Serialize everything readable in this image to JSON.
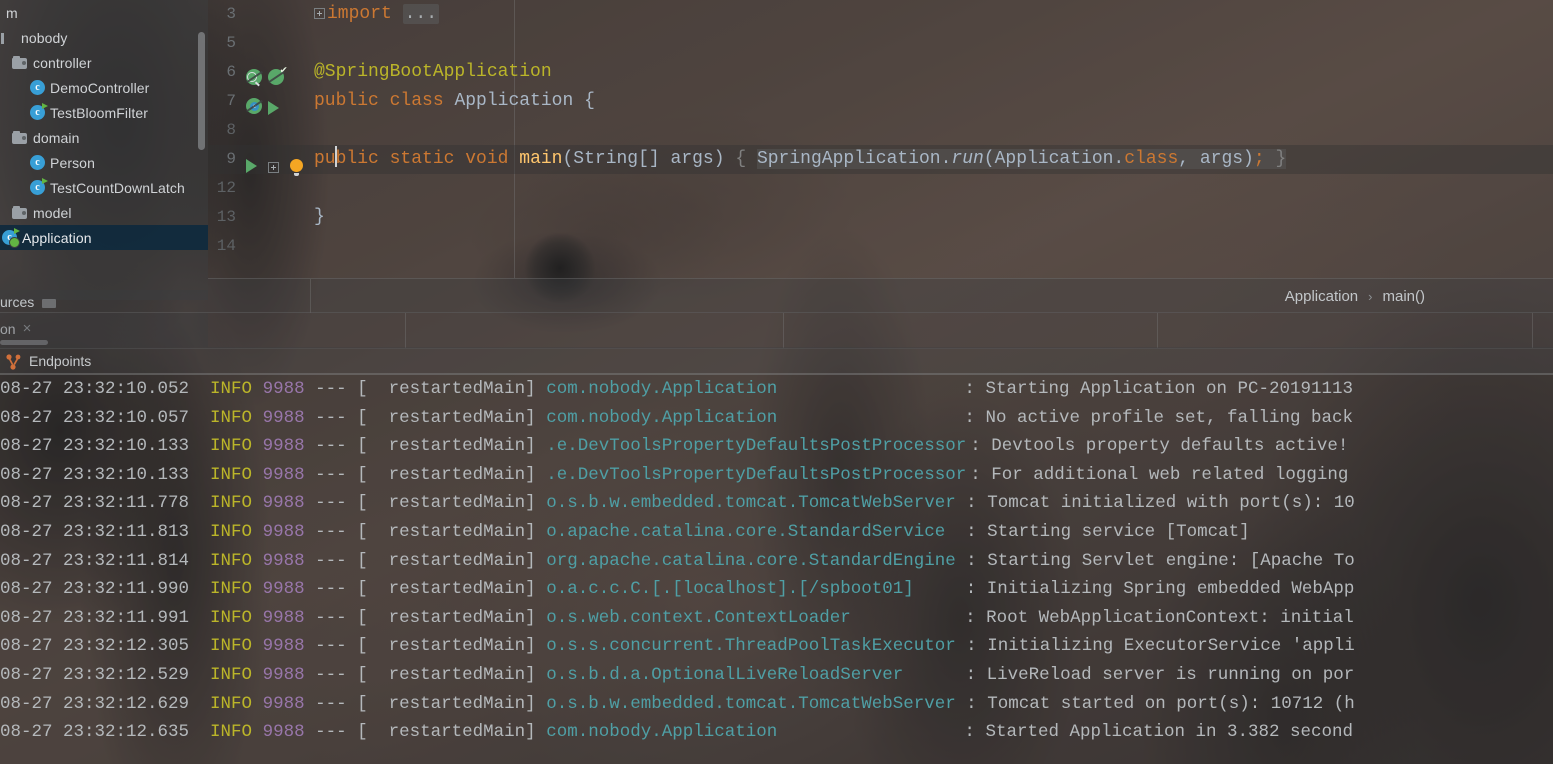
{
  "project_tree": {
    "items": [
      {
        "label": "m",
        "icon": "none",
        "indent": 0,
        "selected": false,
        "clipped": true
      },
      {
        "label": "nobody",
        "icon": "package",
        "indent": 0,
        "selected": false,
        "clipped": true
      },
      {
        "label": "controller",
        "icon": "folder",
        "indent": 12,
        "selected": false,
        "clipped": false
      },
      {
        "label": "DemoController",
        "icon": "java-class",
        "indent": 30,
        "selected": false,
        "clipped": false
      },
      {
        "label": "TestBloomFilter",
        "icon": "java-runnable",
        "indent": 30,
        "selected": false,
        "clipped": false
      },
      {
        "label": "domain",
        "icon": "folder",
        "indent": 12,
        "selected": false,
        "clipped": false
      },
      {
        "label": "Person",
        "icon": "java-class",
        "indent": 30,
        "selected": false,
        "clipped": false
      },
      {
        "label": "TestCountDownLatch",
        "icon": "java-runnable",
        "indent": 30,
        "selected": false,
        "clipped": false
      },
      {
        "label": "model",
        "icon": "folder",
        "indent": 12,
        "selected": false,
        "clipped": false
      },
      {
        "label": "Application",
        "icon": "spring-class",
        "indent": 2,
        "selected": true,
        "clipped": false
      }
    ]
  },
  "left_tabs": {
    "tabs": [
      {
        "label": "urces",
        "close": ""
      },
      {
        "label": "on",
        "close": "×"
      }
    ]
  },
  "editor": {
    "lines": [
      {
        "no": "3",
        "dim": false,
        "current": false,
        "gutter": [],
        "fold": true,
        "tokens": [
          {
            "t": "import ",
            "c": "tok-kw"
          },
          {
            "t": "...",
            "c": "import-ellipsis"
          }
        ]
      },
      {
        "no": "5",
        "dim": false,
        "current": false,
        "gutter": [],
        "fold": false,
        "tokens": []
      },
      {
        "no": "6",
        "dim": false,
        "current": false,
        "gutter": [
          "bean-search",
          "bean-check"
        ],
        "fold": false,
        "tokens": [
          {
            "t": "@SpringBootApplication",
            "c": "tok-ann"
          }
        ]
      },
      {
        "no": "7",
        "dim": false,
        "current": false,
        "gutter": [
          "bean-blue",
          "run"
        ],
        "fold": false,
        "tokens": [
          {
            "t": "public ",
            "c": "tok-kw"
          },
          {
            "t": "class ",
            "c": "tok-kw"
          },
          {
            "t": "Application",
            "c": "tok-type"
          },
          {
            "t": " {",
            "c": "tok-plain"
          }
        ]
      },
      {
        "no": "8",
        "dim": true,
        "current": false,
        "gutter": [],
        "fold": false,
        "tokens": []
      },
      {
        "no": "9",
        "dim": false,
        "current": true,
        "gutter": [
          "run",
          "fold",
          "bulb"
        ],
        "fold": false,
        "tokens": [
          {
            "t": "pu",
            "c": "tok-kw"
          },
          {
            "t": "CARET",
            "c": "caret"
          },
          {
            "t": "blic ",
            "c": "tok-kw"
          },
          {
            "t": "static ",
            "c": "tok-kw"
          },
          {
            "t": "void ",
            "c": "tok-kw"
          },
          {
            "t": "main",
            "c": "tok-method"
          },
          {
            "t": "(",
            "c": "tok-plain"
          },
          {
            "t": "String",
            "c": "tok-type"
          },
          {
            "t": "[] ",
            "c": "tok-plain"
          },
          {
            "t": "args",
            "c": "tok-plain"
          },
          {
            "t": ") ",
            "c": "tok-plain"
          },
          {
            "t": "{ ",
            "c": "tok-dim"
          },
          {
            "t": "SpringApplication.",
            "c": "tok-type hl-usage"
          },
          {
            "t": "run",
            "c": "tok-italic hl-usage"
          },
          {
            "t": "(Application.",
            "c": "tok-type hl-usage"
          },
          {
            "t": "class",
            "c": "tok-kw hl-usage"
          },
          {
            "t": ", args)",
            "c": "tok-type hl-usage"
          },
          {
            "t": ";",
            "c": "tok-kw hl-usage"
          },
          {
            "t": " }",
            "c": "tok-dim hl-usage"
          }
        ]
      },
      {
        "no": "12",
        "dim": true,
        "current": false,
        "gutter": [],
        "fold": false,
        "tokens": []
      },
      {
        "no": "13",
        "dim": true,
        "current": false,
        "gutter": [],
        "fold": false,
        "tokens": [
          {
            "t": "}",
            "c": "tok-plain"
          }
        ]
      },
      {
        "no": "14",
        "dim": true,
        "current": false,
        "gutter": [],
        "fold": false,
        "tokens": []
      }
    ]
  },
  "breadcrumb": {
    "class_name": "Application",
    "separator": "›",
    "method_name": "main()"
  },
  "endpoints": {
    "label": "Endpoints",
    "icon": "endpoints-icon"
  },
  "console": {
    "lines": [
      {
        "time": "08-27 23:32:10.052",
        "level": "INFO",
        "pid": "9988",
        "dash": "---",
        "thread": "[  restartedMain]",
        "logger": "com.nobody.Application",
        "colon": ":",
        "message": "Starting Application on PC-20191113"
      },
      {
        "time": "08-27 23:32:10.057",
        "level": "INFO",
        "pid": "9988",
        "dash": "---",
        "thread": "[  restartedMain]",
        "logger": "com.nobody.Application",
        "colon": ":",
        "message": "No active profile set, falling back"
      },
      {
        "time": "08-27 23:32:10.133",
        "level": "INFO",
        "pid": "9988",
        "dash": "---",
        "thread": "[  restartedMain]",
        "logger": ".e.DevToolsPropertyDefaultsPostProcessor",
        "colon": ":",
        "message": "Devtools property defaults active!"
      },
      {
        "time": "08-27 23:32:10.133",
        "level": "INFO",
        "pid": "9988",
        "dash": "---",
        "thread": "[  restartedMain]",
        "logger": ".e.DevToolsPropertyDefaultsPostProcessor",
        "colon": ":",
        "message": "For additional web related logging"
      },
      {
        "time": "08-27 23:32:11.778",
        "level": "INFO",
        "pid": "9988",
        "dash": "---",
        "thread": "[  restartedMain]",
        "logger": "o.s.b.w.embedded.tomcat.TomcatWebServer",
        "colon": ":",
        "message": "Tomcat initialized with port(s): 10"
      },
      {
        "time": "08-27 23:32:11.813",
        "level": "INFO",
        "pid": "9988",
        "dash": "---",
        "thread": "[  restartedMain]",
        "logger": "o.apache.catalina.core.StandardService",
        "colon": ":",
        "message": "Starting service [Tomcat]"
      },
      {
        "time": "08-27 23:32:11.814",
        "level": "INFO",
        "pid": "9988",
        "dash": "---",
        "thread": "[  restartedMain]",
        "logger": "org.apache.catalina.core.StandardEngine",
        "colon": ":",
        "message": "Starting Servlet engine: [Apache To"
      },
      {
        "time": "08-27 23:32:11.990",
        "level": "INFO",
        "pid": "9988",
        "dash": "---",
        "thread": "[  restartedMain]",
        "logger": "o.a.c.c.C.[.[localhost].[/spboot01]",
        "colon": ":",
        "message": "Initializing Spring embedded WebApp"
      },
      {
        "time": "08-27 23:32:11.991",
        "level": "INFO",
        "pid": "9988",
        "dash": "---",
        "thread": "[  restartedMain]",
        "logger": "o.s.web.context.ContextLoader",
        "colon": ":",
        "message": "Root WebApplicationContext: initial"
      },
      {
        "time": "08-27 23:32:12.305",
        "level": "INFO",
        "pid": "9988",
        "dash": "---",
        "thread": "[  restartedMain]",
        "logger": "o.s.s.concurrent.ThreadPoolTaskExecutor",
        "colon": ":",
        "message": "Initializing ExecutorService 'appli"
      },
      {
        "time": "08-27 23:32:12.529",
        "level": "INFO",
        "pid": "9988",
        "dash": "---",
        "thread": "[  restartedMain]",
        "logger": "o.s.b.d.a.OptionalLiveReloadServer",
        "colon": ":",
        "message": "LiveReload server is running on por"
      },
      {
        "time": "08-27 23:32:12.629",
        "level": "INFO",
        "pid": "9988",
        "dash": "---",
        "thread": "[  restartedMain]",
        "logger": "o.s.b.w.embedded.tomcat.TomcatWebServer",
        "colon": ":",
        "message": "Tomcat started on port(s): 10712 (h"
      },
      {
        "time": "08-27 23:32:12.635",
        "level": "INFO",
        "pid": "9988",
        "dash": "---",
        "thread": "[  restartedMain]",
        "logger": "com.nobody.Application",
        "colon": ":",
        "message": "Started Application in 3.382 second"
      }
    ]
  },
  "colors": {
    "selection_blue": "#0d293e",
    "keyword_orange": "#cc7832",
    "annotation_yellow": "#bbb529",
    "identifier_grey": "#a9b7c6",
    "method_gold": "#ffc66d",
    "logger_teal": "#4f9fa5",
    "level_info": "#bbb529",
    "pid_purple": "#9876aa",
    "spring_green": "#59a869",
    "endpoints_orange": "#d2703a",
    "bulb_amber": "#f5a623",
    "class_icon_blue": "#389fd6"
  }
}
